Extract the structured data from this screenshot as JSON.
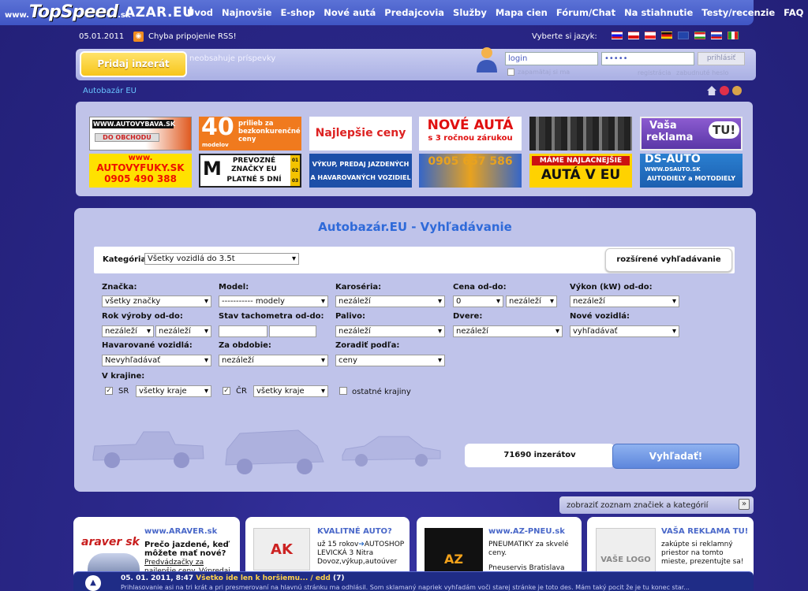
{
  "site": {
    "prefix": "www.",
    "name": "TopSpeed",
    "suffix": ".sk",
    "brand": "AZAR.EU"
  },
  "nav": [
    "Úvod",
    "Najnovšie",
    "E-shop",
    "Nové autá",
    "Predajcovia",
    "Služby",
    "Mapa cien",
    "Fórum/Chat",
    "Na stiahnutie",
    "Testy/recenzie",
    "FAQ"
  ],
  "status": {
    "date": "05.01.2011",
    "rss": "Chyba pripojenie RSS!",
    "lang_label": "Vyberte si jazyk:"
  },
  "flags": [
    "#c11",
    "#d22",
    "#fff",
    "#e33",
    "#333",
    "#449",
    "#e44",
    "#393"
  ],
  "login": {
    "pridaj": "Pridaj inzerát",
    "notice": "neobsahuje príspevky",
    "login_placeholder": "login",
    "password_mask": "•••••",
    "submit": "prihlásiť",
    "remember": "zapamätaj si ma",
    "register": "registrácia",
    "forgot": "zabudnuté heslo"
  },
  "breadcrumb": "Autobazár EU",
  "banners": {
    "b1": {
      "line1": "WWW.AUTOVYBAVA.SK",
      "line2": "DO OBCHODU"
    },
    "b2": {
      "num": "40",
      "small": "modelov",
      "text": "prilieb za bezkonkurenčné ceny"
    },
    "b3": "Najlepšie ceny",
    "b4": {
      "line1": "NOVÉ AUTÁ",
      "line2": "s 3 ročnou zárukou"
    },
    "b6": {
      "line1": "Vaša",
      "line2": "reklama",
      "line3": "TU!"
    },
    "b7": {
      "line1": "www.",
      "line2": "AUTOVYFUKY.SK",
      "line3": "0905 490 388"
    },
    "b8": {
      "letter": "M",
      "line1": "PREVOZNÉ",
      "line2": "ZNAČKY EU",
      "line3": "PLATNÉ 5 DNÍ",
      "codes": [
        "01",
        "02",
        "03"
      ]
    },
    "b9": {
      "line1": "VÝKUP, PREDAJ JAZDENÝCH",
      "line2": "A HAVAROVANÝCH VOZIDIEL"
    },
    "b10": "0905 657 586",
    "b11": {
      "line1": "MÁME NAJLACNEJŠIE",
      "line2": "AUTÁ V EU"
    },
    "b12": {
      "line1": "DS-AUTO",
      "line2": "WWW.DSAUTO.SK",
      "line3": "AUTODIELY a MOTODIELY"
    }
  },
  "search": {
    "title": "Autobazár.EU - Vyhľadávanie",
    "kategoria_label": "Kategória:",
    "kategoria_value": "Všetky vozidlá do 3.5t",
    "advanced": "rozšírené vyhľadávanie",
    "fields": {
      "znacka": {
        "label": "Značka:",
        "value": "všetky značky"
      },
      "model": {
        "label": "Model:",
        "value": "----------- modely"
      },
      "karoseria": {
        "label": "Karoséria:",
        "value": "nezáleží"
      },
      "cena": {
        "label": "Cena od-do:",
        "from": "0",
        "to": "nezáleží"
      },
      "vykon": {
        "label": "Výkon (kW) od-do:",
        "value": "nezáleží"
      },
      "rok": {
        "label": "Rok výroby od-do:",
        "from": "nezáleží",
        "to": "nezáleží"
      },
      "tacho": {
        "label": "Stav tachometra od-do:"
      },
      "palivo": {
        "label": "Palivo:",
        "value": "nezáleží"
      },
      "dvere": {
        "label": "Dvere:",
        "value": "nezáleží"
      },
      "nove": {
        "label": "Nové vozidlá:",
        "value": "vyhľadávať"
      },
      "havar": {
        "label": "Havarované vozidlá:",
        "value": "Nevyhľadávať"
      },
      "obdobie": {
        "label": "Za obdobie:",
        "value": "nezáleží"
      },
      "zoradit": {
        "label": "Zoradiť podľa:",
        "value": "ceny"
      }
    },
    "krajine": {
      "label": "V krajine:",
      "sr": "SR",
      "sr_value": "všetky kraje",
      "cr": "ČR",
      "cr_value": "všetky kraje",
      "other": "ostatné krajiny"
    },
    "count": "71690 inzerátov",
    "submit": "Vyhľadať!"
  },
  "listbar": "zobraziť zoznam značiek a kategórií",
  "cards": [
    {
      "title": "www.ARAVER.sk",
      "logo": "araver sk",
      "text1": "Prečo jazdené, keď",
      "text2": "môžete mať nové?",
      "text3": "Predvádzačky za",
      "text4": "najlepšie ceny. Výpredaj"
    },
    {
      "title": "KVALITNÉ AUTO?",
      "logo": "AK",
      "text1": "už 15 rokov",
      "text1b": "AUTOSHOP",
      "text2": "LEVICKÁ 3 Nitra",
      "text3": "Dovoz,výkup,autoúver"
    },
    {
      "title": "www.AZ-PNEU.sk",
      "logo": "AZ pneu",
      "text1": "PNEUMATIKY za skvelé",
      "text2": "ceny.",
      "text3": "Pneuservis Bratislava"
    },
    {
      "title": "VAŠA REKLAMA TU!",
      "logo": "VAŠE LOGO",
      "text1": "zakúpte si reklamný",
      "text2": "priestor na tomto",
      "text3": "mieste, prezentujte sa!"
    }
  ],
  "ticker": {
    "date": "05. 01. 2011, 8:47",
    "headline": "Všetko ide len k horšiemu... / edd",
    "count": "(7)",
    "text": "Prihlasovanie asi na tri krát a pri presmerovaní na hlavnú stránku ma odhlásil. Som sklamaný napriek vyhľadám voči starej stránke je toto des. Mám taký pocit že je tu konec star..."
  }
}
